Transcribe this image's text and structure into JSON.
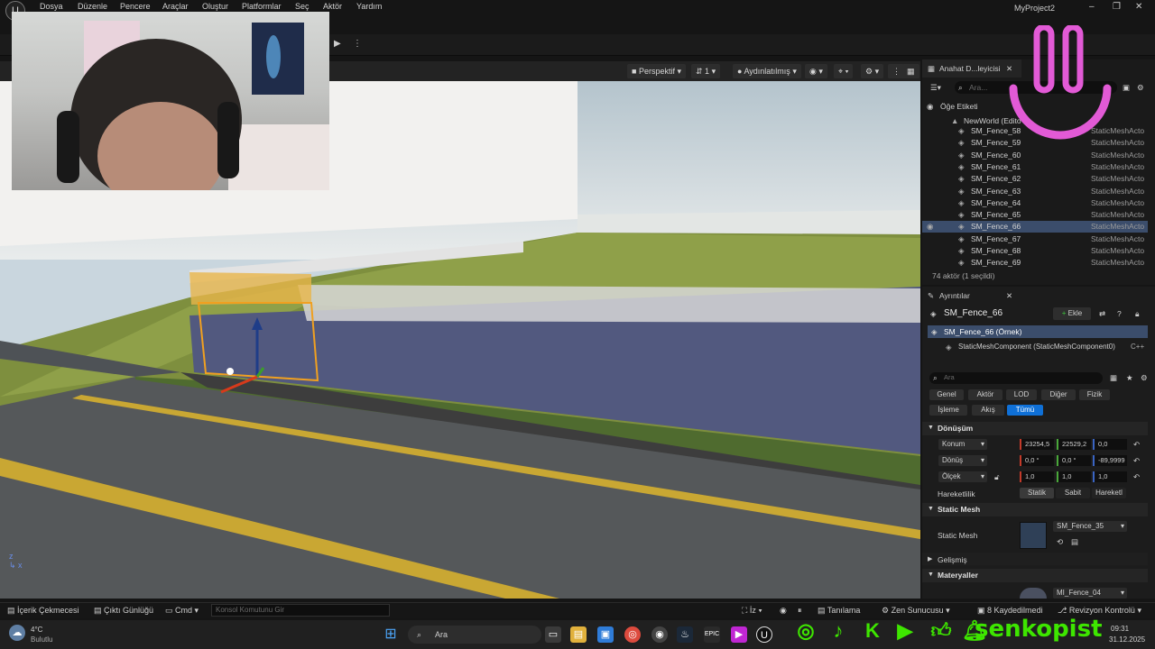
{
  "menu": {
    "items": [
      "Dosya",
      "Düzenle",
      "Pencere",
      "Araçlar",
      "Oluştur",
      "Platformlar",
      "Seç",
      "Aktör",
      "Yardım"
    ],
    "project_title": "MyProject2"
  },
  "viewport": {
    "perspective": "Perspektif",
    "lit": "Aydınlatılmış",
    "camera_speed": "1"
  },
  "outliner": {
    "tab_title": "Anahat D...leyicisi",
    "search_placeholder": "Ara...",
    "column_label": "Öğe Etiketi",
    "world": "NewWorld (Edito",
    "rows": [
      {
        "name": "SM_Fence_58",
        "type": "StaticMeshActo",
        "selected": false
      },
      {
        "name": "SM_Fence_59",
        "type": "StaticMeshActo",
        "selected": false
      },
      {
        "name": "SM_Fence_60",
        "type": "StaticMeshActo",
        "selected": false
      },
      {
        "name": "SM_Fence_61",
        "type": "StaticMeshActo",
        "selected": false
      },
      {
        "name": "SM_Fence_62",
        "type": "StaticMeshActo",
        "selected": false
      },
      {
        "name": "SM_Fence_63",
        "type": "StaticMeshActo",
        "selected": false
      },
      {
        "name": "SM_Fence_64",
        "type": "StaticMeshActo",
        "selected": false
      },
      {
        "name": "SM_Fence_65",
        "type": "StaticMeshActo",
        "selected": false
      },
      {
        "name": "SM_Fence_66",
        "type": "StaticMeshActo",
        "selected": true
      },
      {
        "name": "SM_Fence_67",
        "type": "StaticMeshActo",
        "selected": false
      },
      {
        "name": "SM_Fence_68",
        "type": "StaticMeshActo",
        "selected": false
      },
      {
        "name": "SM_Fence_69",
        "type": "StaticMeshActo",
        "selected": false
      }
    ],
    "count": "74 aktör (1 seçildi)"
  },
  "details": {
    "tab_title": "Ayrıntılar",
    "actor_name": "SM_Fence_66",
    "add_label": "Ekle",
    "instance": "SM_Fence_66 (Örnek)",
    "component": "StaticMeshComponent (StaticMeshComponent0)",
    "component_tag": "C++",
    "search_placeholder": "Ara",
    "filters": [
      "Genel",
      "Aktör",
      "LOD",
      "Diğer",
      "Fizik",
      "İşleme",
      "Akış",
      "Tümü"
    ],
    "transform_section": "Dönüşüm",
    "location_label": "Konum",
    "location": [
      "23254,5",
      "22529,2",
      "0,0"
    ],
    "rotation_label": "Dönüş",
    "rotation": [
      "0,0 °",
      "0,0 °",
      "-89,9999"
    ],
    "scale_label": "Ölçek",
    "scale": [
      "1,0",
      "1,0",
      "1,0"
    ],
    "mobility_label": "Hareketlilik",
    "mobility_options": [
      "Statik",
      "Sabit",
      "Hareketl"
    ],
    "static_mesh_section": "Static Mesh",
    "static_mesh_label": "Static Mesh",
    "static_mesh_value": "SM_Fence_35",
    "advanced": "Gelişmiş",
    "materials_section": "Materyaller",
    "material_value": "MI_Fence_04"
  },
  "statusbar": {
    "content_drawer": "İçerik Çekmecesi",
    "output_log": "Çıktı Günlüğü",
    "cmd": "Cmd",
    "cmd_placeholder": "Konsol Komutunu Gir",
    "unsaved": "8 Kaydedilmedi",
    "revision": "Revizyon Kontrolü",
    "derived_data": "Tanılama",
    "zen": "Zen Sunucusu",
    "trace": "İz"
  },
  "taskbar": {
    "weather_temp": "4°C",
    "weather_desc": "Bulutlu",
    "search": "Ara",
    "time": "09:31",
    "date": "31.12.2025"
  },
  "overlay": {
    "brand": "senkopist"
  }
}
